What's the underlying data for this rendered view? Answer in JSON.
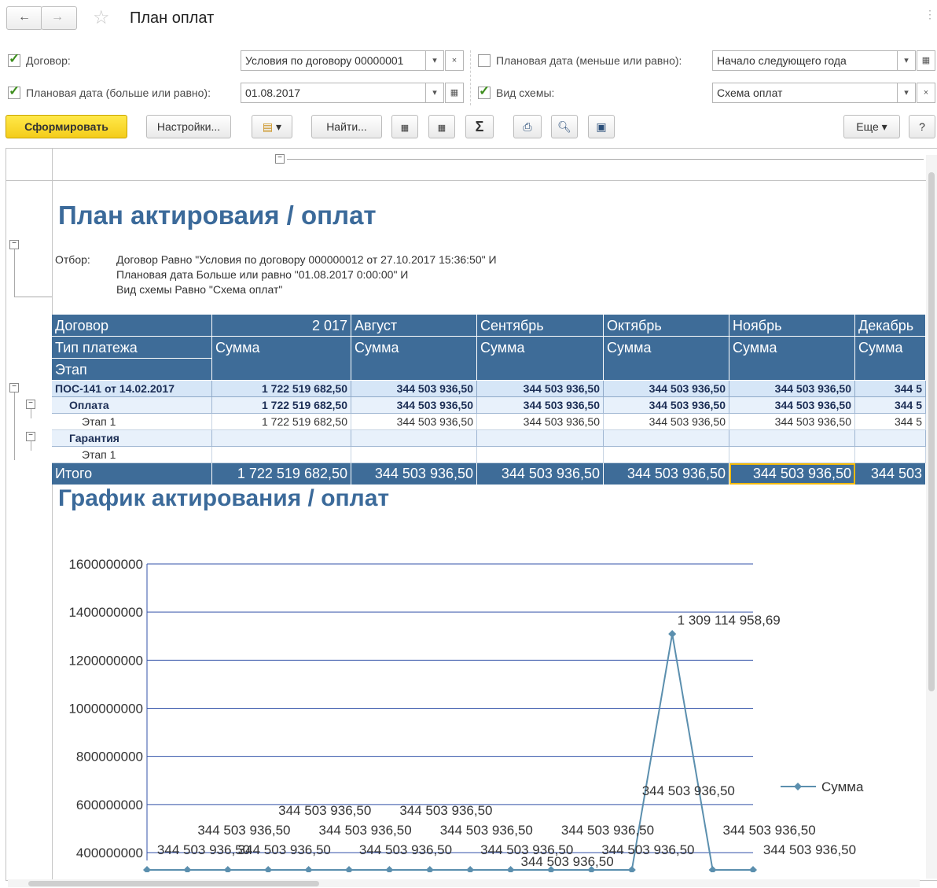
{
  "window": {
    "title": "План оплат"
  },
  "filters": {
    "dogovor": {
      "label": "Договор:",
      "value": "Условия по договору 00000001",
      "checked": true
    },
    "date_ge": {
      "label": "Плановая дата (больше или равно):",
      "value": "01.08.2017",
      "checked": true
    },
    "date_le": {
      "label": "Плановая дата (меньше или равно):",
      "value": "Начало следующего года",
      "checked": false
    },
    "scheme": {
      "label": "Вид схемы:",
      "value": "Схема оплат",
      "checked": true
    }
  },
  "toolbar": {
    "generate": "Сформировать",
    "settings": "Настройки...",
    "find": "Найти...",
    "sigma": "Σ",
    "more": "Еще",
    "help": "?"
  },
  "report": {
    "title": "План актироваия / оплат",
    "filter_label": "Отбор:",
    "filter_lines": [
      "Договор Равно \"Условия по договору 000000012 от 27.10.2017 15:36:50\" И",
      "Плановая дата Больше или равно \"01.08.2017 0:00:00\" И",
      "Вид схемы Равно \"Схема оплат\""
    ],
    "headers": {
      "row1": [
        "Договор",
        "2 017",
        "Август",
        "Сентябрь",
        "Октябрь",
        "Ноябрь",
        "Декабрь"
      ],
      "row2": [
        "Тип платежа",
        "Сумма",
        "Сумма",
        "Сумма",
        "Сумма",
        "Сумма",
        "Сумма"
      ],
      "row3": [
        "Этап"
      ]
    },
    "rows": [
      {
        "kind": "grp",
        "label": "ПОС-141 от 14.02.2017",
        "values": [
          "1 722 519 682,50",
          "344 503 936,50",
          "344 503 936,50",
          "344 503 936,50",
          "344 503 936,50",
          "344 5"
        ]
      },
      {
        "kind": "grp2",
        "label": "Оплата",
        "values": [
          "1 722 519 682,50",
          "344 503 936,50",
          "344 503 936,50",
          "344 503 936,50",
          "344 503 936,50",
          "344 5"
        ]
      },
      {
        "kind": "det",
        "label": "Этап 1",
        "values": [
          "1 722 519 682,50",
          "344 503 936,50",
          "344 503 936,50",
          "344 503 936,50",
          "344 503 936,50",
          "344 5"
        ]
      },
      {
        "kind": "grp2",
        "label": "Гарантия",
        "values": [
          "",
          "",
          "",
          "",
          "",
          ""
        ]
      },
      {
        "kind": "det",
        "label": "Этап 1",
        "values": [
          "",
          "",
          "",
          "",
          "",
          ""
        ]
      }
    ],
    "total": {
      "label": "Итого",
      "values": [
        "1 722 519 682,50",
        "344 503 936,50",
        "344 503 936,50",
        "344 503 936,50",
        "344 503 936,50",
        "344 503"
      ]
    },
    "chart_title": "График актирования / оплат"
  },
  "chart_data": {
    "type": "line",
    "title": "График актирования / оплат",
    "ylim": [
      400000000,
      1600000000
    ],
    "yticks": [
      "1600000000",
      "1400000000",
      "1200000000",
      "1000000000",
      "800000000",
      "600000000",
      "400000000"
    ],
    "grid": true,
    "legend_position": "right",
    "series": [
      {
        "name": "Сумма",
        "color": "#5b8fae",
        "values": [
          344503936.5,
          344503936.5,
          344503936.5,
          344503936.5,
          344503936.5,
          344503936.5,
          344503936.5,
          344503936.5,
          344503936.5,
          344503936.5,
          344503936.5,
          344503936.5,
          344503936.5,
          1309114958.69,
          344503936.5,
          344503936.5
        ]
      }
    ],
    "point_labels": [
      "344 503 936,50",
      "344 503 936,50",
      "344 503 936,50",
      "344 503 936,50",
      "344 503 936,50",
      "344 503 936,50",
      "344 503 936,50",
      "344 503 936,50",
      "344 503 936,50",
      "344 503 936,50",
      "344 503 936,50",
      "344 503 936,50",
      "344 503 936,50",
      "1 309 114 958,69",
      "344 503 936,50",
      "344 503 936,50"
    ]
  }
}
